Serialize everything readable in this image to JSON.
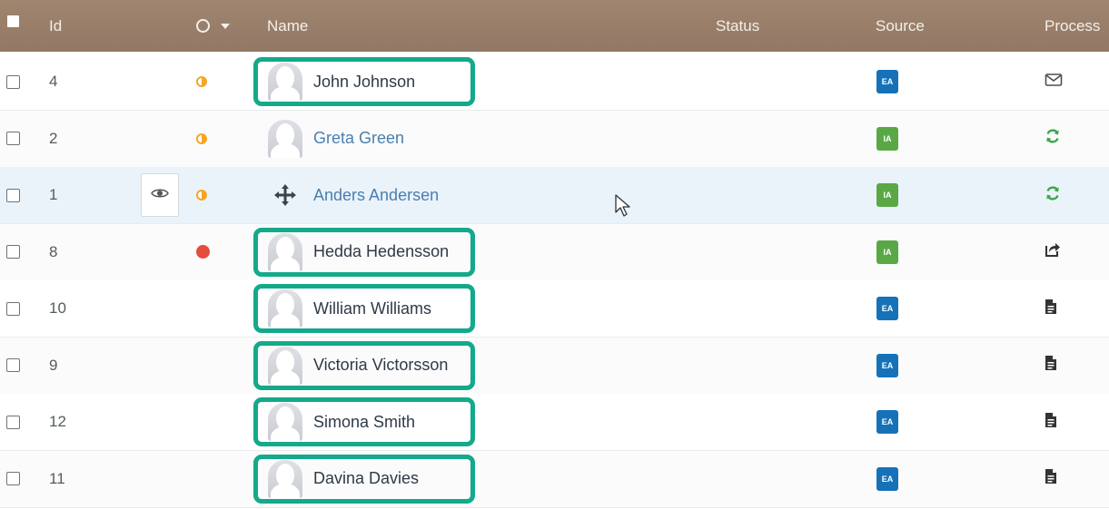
{
  "header": {
    "id": "Id",
    "name": "Name",
    "status": "Status",
    "source": "Source",
    "process": "Process"
  },
  "colors": {
    "header_bg": "#927865",
    "highlight": "#14a98a",
    "ea_badge": "#1672b8",
    "ia_badge": "#5aa845",
    "status_partial": "#f5a623",
    "status_alert": "#e44c3c",
    "refresh_icon": "#3aa64a"
  },
  "rows": [
    {
      "id": "4",
      "name": "John Johnson",
      "status_icon": "half-circle-icon",
      "source": "EA",
      "process_icon": "envelope-icon",
      "highlighted": true
    },
    {
      "id": "2",
      "name": "Greta Green",
      "status_icon": "half-circle-icon",
      "source": "IA",
      "process_icon": "refresh-icon",
      "highlighted": false
    },
    {
      "id": "1",
      "name": "Anders Andersen",
      "status_icon": "half-circle-icon",
      "source": "IA",
      "process_icon": "refresh-icon",
      "highlighted": false,
      "hovered": true
    },
    {
      "id": "8",
      "name": "Hedda Hedensson",
      "status_icon": "red-dot-icon",
      "source": "IA",
      "process_icon": "share-icon",
      "highlighted": true
    },
    {
      "id": "10",
      "name": "William Williams",
      "status_icon": "",
      "source": "EA",
      "process_icon": "document-icon",
      "highlighted": true
    },
    {
      "id": "9",
      "name": "Victoria Victorsson",
      "status_icon": "",
      "source": "EA",
      "process_icon": "document-icon",
      "highlighted": true
    },
    {
      "id": "12",
      "name": "Simona Smith",
      "status_icon": "",
      "source": "EA",
      "process_icon": "document-icon",
      "highlighted": true
    },
    {
      "id": "11",
      "name": "Davina Davies",
      "status_icon": "",
      "source": "EA",
      "process_icon": "document-icon",
      "highlighted": true
    }
  ]
}
